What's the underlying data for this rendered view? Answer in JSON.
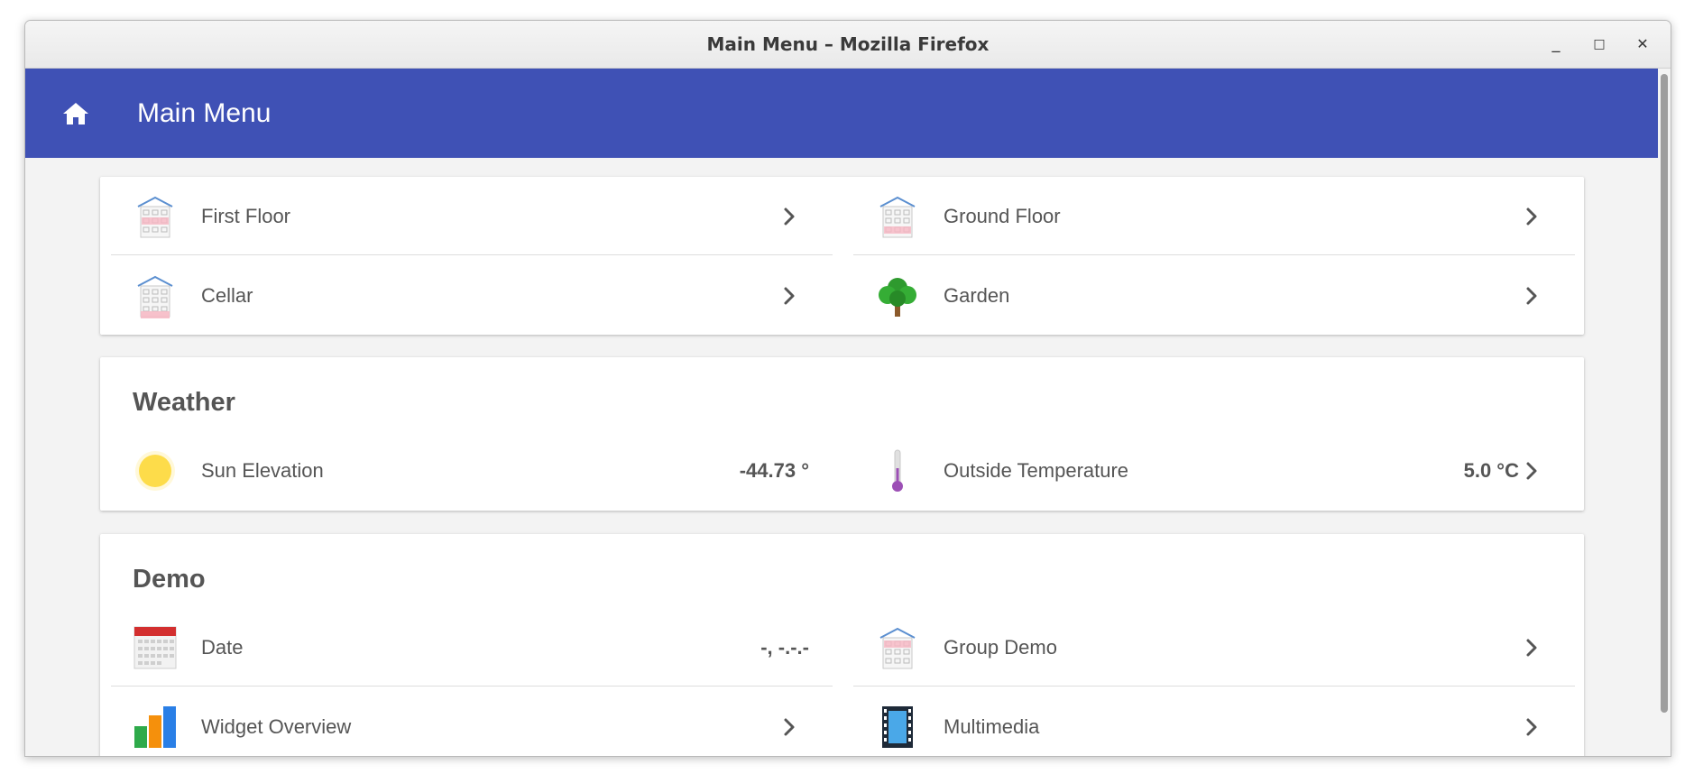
{
  "window": {
    "title": "Main Menu – Mozilla Firefox",
    "minimize": "_",
    "maximize": "□",
    "close": "✕"
  },
  "appbar": {
    "title": "Main Menu",
    "color": "#3f51b5"
  },
  "sections": {
    "floors": {
      "items": [
        {
          "label": "First Floor",
          "icon": "house-first-floor-icon"
        },
        {
          "label": "Ground Floor",
          "icon": "house-ground-floor-icon"
        },
        {
          "label": "Cellar",
          "icon": "house-cellar-icon"
        },
        {
          "label": "Garden",
          "icon": "tree-icon"
        }
      ]
    },
    "weather": {
      "heading": "Weather",
      "items": [
        {
          "label": "Sun Elevation",
          "value": "-44.73 °",
          "icon": "sun-icon"
        },
        {
          "label": "Outside Temperature",
          "value": "5.0 °C",
          "icon": "thermometer-icon"
        }
      ]
    },
    "demo": {
      "heading": "Demo",
      "items": [
        {
          "label": "Date",
          "value": "-, -.-.-",
          "icon": "calendar-icon"
        },
        {
          "label": "Group Demo",
          "icon": "house-icon"
        },
        {
          "label": "Widget Overview",
          "icon": "bar-chart-icon"
        },
        {
          "label": "Multimedia",
          "icon": "film-icon"
        }
      ]
    }
  }
}
